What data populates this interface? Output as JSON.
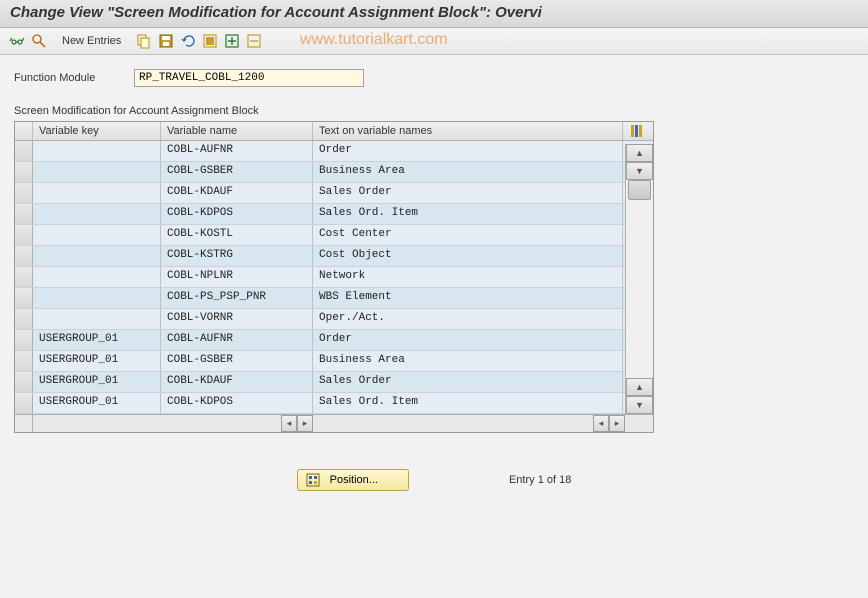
{
  "title": "Change View \"Screen Modification for Account Assignment Block\": Overvi",
  "toolbar": {
    "new_entries": "New Entries"
  },
  "watermark": "www.tutorialkart.com",
  "function_module": {
    "label": "Function Module",
    "value": "RP_TRAVEL_COBL_1200"
  },
  "table": {
    "title": "Screen Modification for Account Assignment Block",
    "columns": {
      "variable_key": "Variable key",
      "variable_name": "Variable name",
      "text": "Text on variable names"
    },
    "rows": [
      {
        "key": "",
        "name": "COBL-AUFNR",
        "text": "Order"
      },
      {
        "key": "",
        "name": "COBL-GSBER",
        "text": "Business Area"
      },
      {
        "key": "",
        "name": "COBL-KDAUF",
        "text": "Sales Order"
      },
      {
        "key": "",
        "name": "COBL-KDPOS",
        "text": "Sales Ord. Item"
      },
      {
        "key": "",
        "name": "COBL-KOSTL",
        "text": "Cost Center"
      },
      {
        "key": "",
        "name": "COBL-KSTRG",
        "text": "Cost Object"
      },
      {
        "key": "",
        "name": "COBL-NPLNR",
        "text": "Network"
      },
      {
        "key": "",
        "name": "COBL-PS_PSP_PNR",
        "text": "WBS Element"
      },
      {
        "key": "",
        "name": "COBL-VORNR",
        "text": "Oper./Act."
      },
      {
        "key": "USERGROUP_01",
        "name": "COBL-AUFNR",
        "text": "Order"
      },
      {
        "key": "USERGROUP_01",
        "name": "COBL-GSBER",
        "text": "Business Area"
      },
      {
        "key": "USERGROUP_01",
        "name": "COBL-KDAUF",
        "text": "Sales Order"
      },
      {
        "key": "USERGROUP_01",
        "name": "COBL-KDPOS",
        "text": "Sales Ord. Item"
      }
    ]
  },
  "position_button": "Position...",
  "entry_counter": "Entry 1 of 18",
  "icons": {
    "glasses": "glasses-icon",
    "find": "find-icon",
    "copy": "copy-icon",
    "save": "save-icon",
    "undo": "undo-icon",
    "select_all": "select-all-icon",
    "expand": "expand-icon",
    "collapse": "collapse-icon"
  }
}
